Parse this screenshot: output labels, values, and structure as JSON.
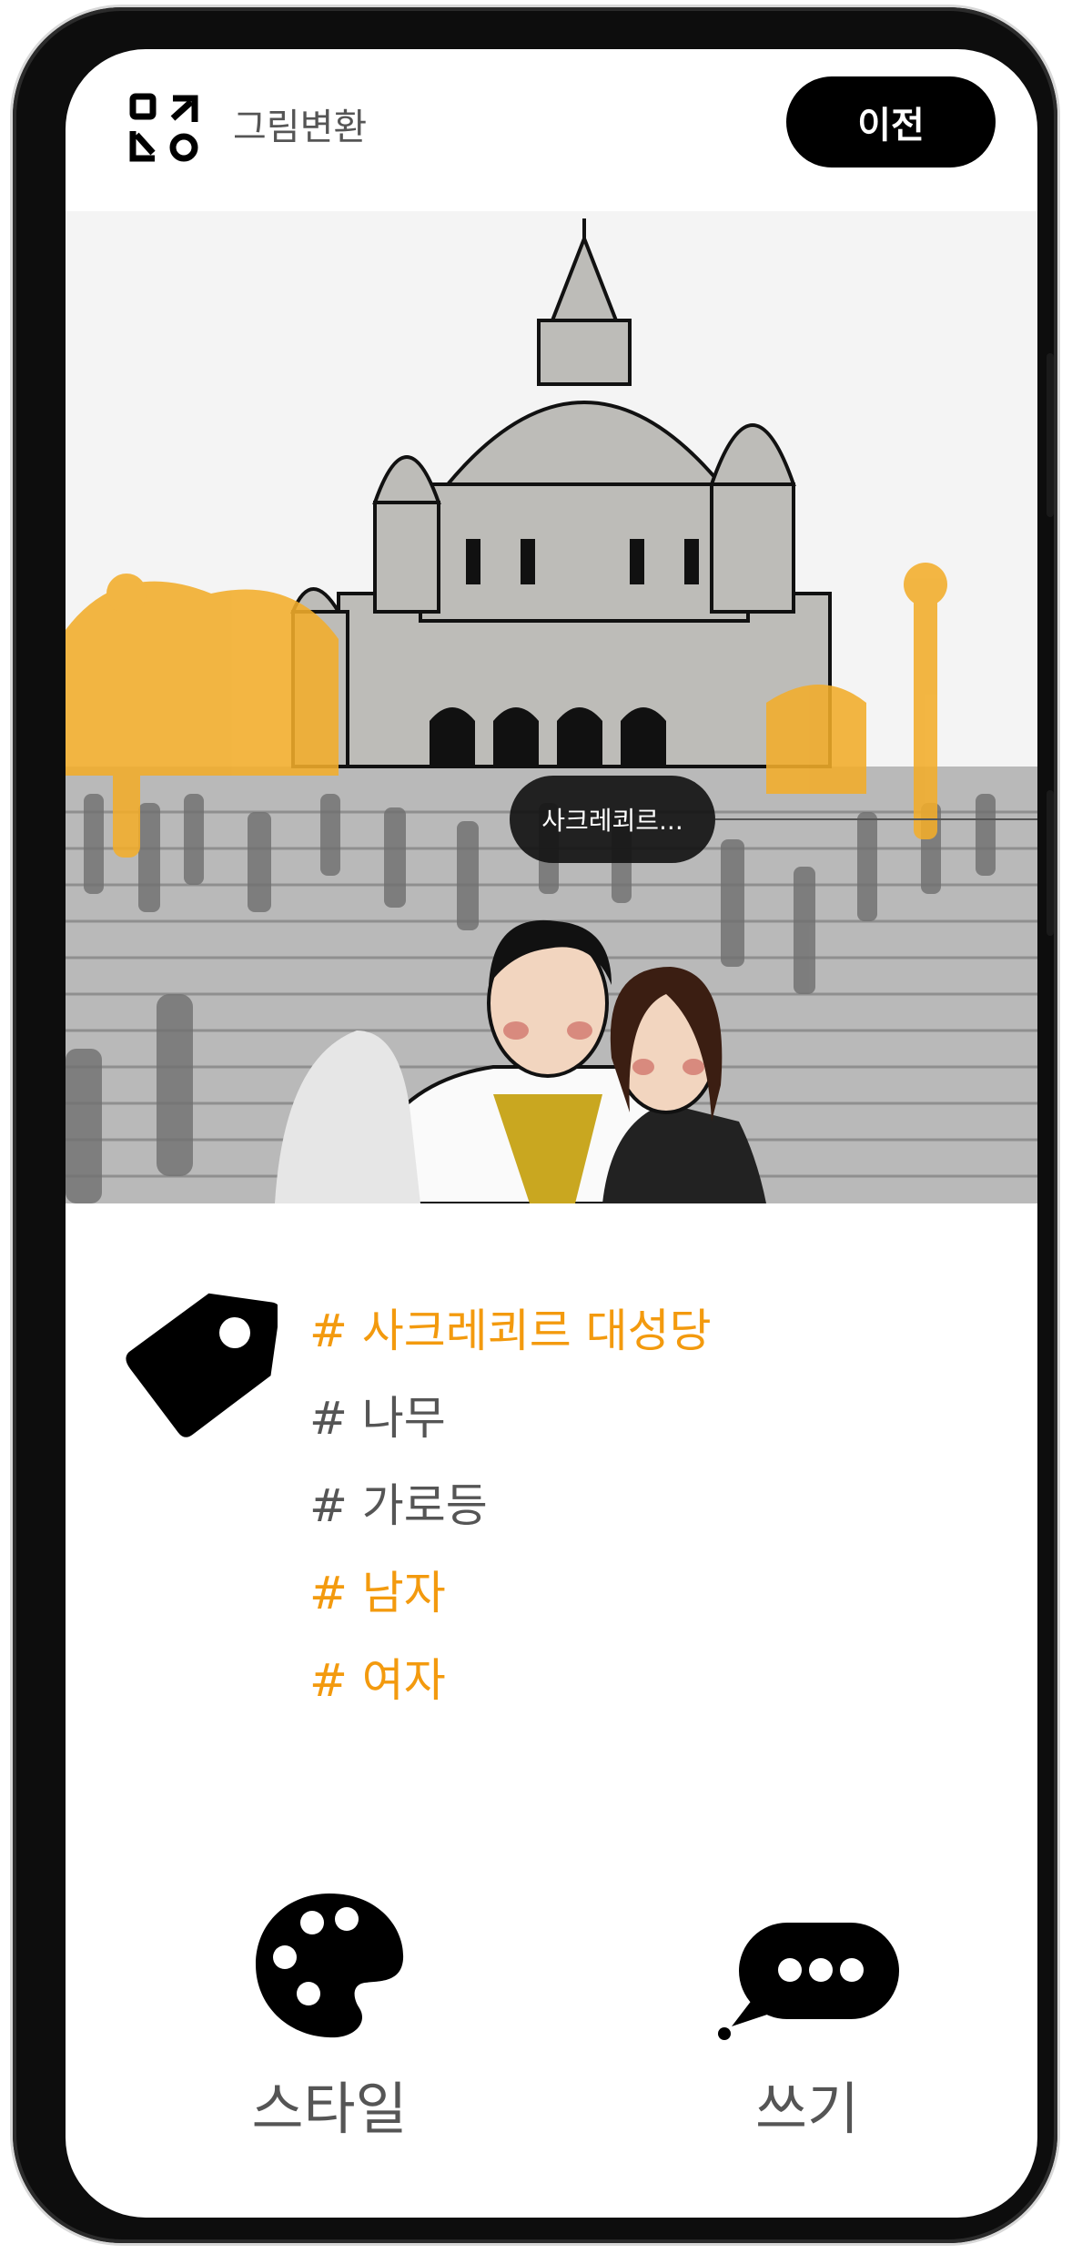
{
  "appbar": {
    "title": "그림변환",
    "prev_label": "이전",
    "logo_icon": "convert-icon"
  },
  "photo": {
    "tooltip": "사크레쾨르..."
  },
  "tags": {
    "icon": "tag-icon",
    "items": [
      {
        "label": "# 사크레쾨르 대성당",
        "highlighted": true
      },
      {
        "label": "# 나무",
        "highlighted": false
      },
      {
        "label": "# 가로등",
        "highlighted": false
      },
      {
        "label": "# 남자",
        "highlighted": true
      },
      {
        "label": "# 여자",
        "highlighted": true
      }
    ]
  },
  "actions": {
    "style_label": "스타일",
    "write_label": "쓰기"
  },
  "colors": {
    "accent": "#f39a0e",
    "highlight_overlay": "#f2ad2a",
    "button": "#000000"
  }
}
